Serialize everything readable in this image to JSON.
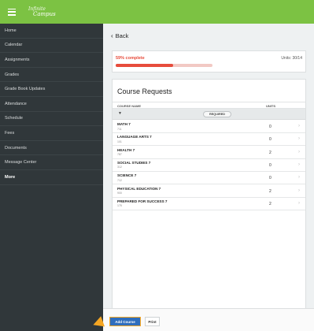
{
  "header": {
    "logo_line1": "Infinite",
    "logo_line2": "Campus"
  },
  "sidebar": {
    "items": [
      {
        "label": "Home"
      },
      {
        "label": "Calendar"
      },
      {
        "label": "Assignments"
      },
      {
        "label": "Grades"
      },
      {
        "label": "Grade Book Updates"
      },
      {
        "label": "Attendance"
      },
      {
        "label": "Schedule"
      },
      {
        "label": "Fees"
      },
      {
        "label": "Documents"
      },
      {
        "label": "Message Center"
      },
      {
        "label": "More"
      }
    ],
    "active_index": 10
  },
  "main": {
    "back_label": "Back",
    "progress": {
      "text": "59% complete",
      "units": "Units: 30/14",
      "percent": 59
    },
    "requests": {
      "title": "Course Requests",
      "col_course": "COURSE NAME",
      "col_units": "UNITS",
      "group_label": "REQUIRED",
      "courses": [
        {
          "name": "MATH 7",
          "code": "711",
          "units": "0"
        },
        {
          "name": "LANGUAGE ARTS 7",
          "code": "101",
          "units": "0"
        },
        {
          "name": "HEALTH 7",
          "code": "787",
          "units": "2"
        },
        {
          "name": "SOCIAL STUDIES 7",
          "code": "312",
          "units": "0"
        },
        {
          "name": "SCIENCE 7",
          "code": "712",
          "units": "0"
        },
        {
          "name": "PHYSICAL EDUCATION 7",
          "code": "900",
          "units": "2"
        },
        {
          "name": "PREPARED FOR SUCCESS 7",
          "code": "175",
          "units": "2"
        }
      ]
    }
  },
  "footer": {
    "add_label": "Add Course",
    "print_label": "Print"
  },
  "colors": {
    "brand_green": "#7cc243",
    "sidebar_bg": "#30373a",
    "progress_red": "#e74c3c",
    "button_blue": "#2f6ebd",
    "highlight_orange": "#f5a623"
  }
}
